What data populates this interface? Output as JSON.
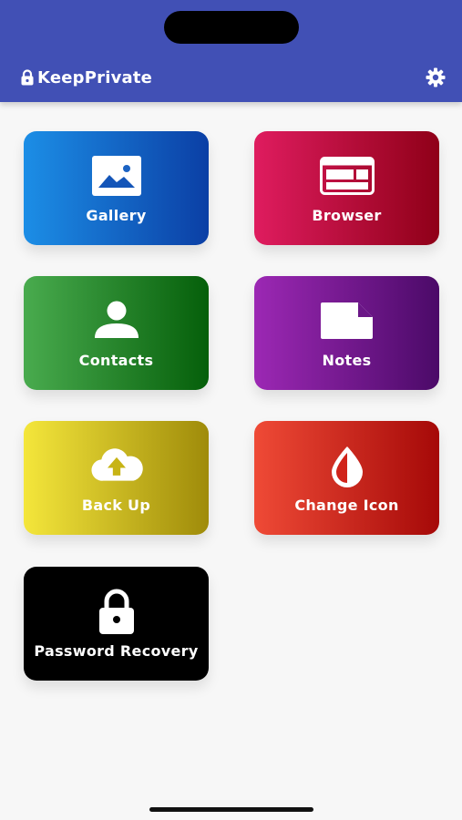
{
  "header": {
    "app_name": "KeepPrivate",
    "lock_icon": "lock-icon",
    "settings_icon": "gear-icon",
    "background": "#4150b5"
  },
  "tiles": [
    {
      "label": "Gallery",
      "icon": "image-icon"
    },
    {
      "label": "Browser",
      "icon": "browser-window-icon"
    },
    {
      "label": "Contacts",
      "icon": "person-icon"
    },
    {
      "label": "Notes",
      "icon": "note-icon"
    },
    {
      "label": "Back Up",
      "icon": "cloud-upload-icon"
    },
    {
      "label": "Change Icon",
      "icon": "droplet-half-icon"
    },
    {
      "label": "Password Recovery",
      "icon": "lock-icon"
    }
  ]
}
